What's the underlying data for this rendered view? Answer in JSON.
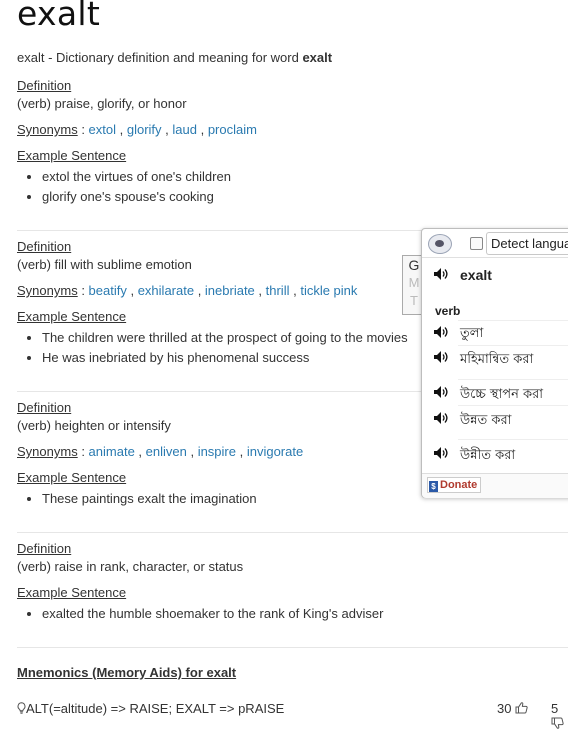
{
  "word": "exalt",
  "intro": {
    "prefix": "exalt - Dictionary definition and meaning for word ",
    "word": "exalt"
  },
  "labels": {
    "definition": "Definition",
    "synonyms": "Synonyms",
    "colon": " : ",
    "example": "Example Sentence"
  },
  "senses": [
    {
      "def": "(verb) praise, glorify, or honor",
      "synonyms": [
        "extol",
        "glorify",
        "laud",
        "proclaim"
      ],
      "examples": [
        "extol the virtues of one's children",
        "glorify one's spouse's cooking"
      ]
    },
    {
      "def": "(verb) fill with sublime emotion",
      "synonyms": [
        "beatify",
        "exhilarate",
        "inebriate",
        "thrill",
        "tickle pink"
      ],
      "examples": [
        "The children were thrilled at the prospect of going to the movies",
        "He was inebriated by his phenomenal success"
      ]
    },
    {
      "def": "(verb) heighten or intensify",
      "synonyms": [
        "animate",
        "enliven",
        "inspire",
        "invigorate"
      ],
      "examples": [
        "These paintings exalt the imagination"
      ]
    },
    {
      "def": "(verb) raise in rank, character, or status",
      "synonyms": [],
      "examples": [
        "exalted the humble shoemaker to the rank of King's adviser"
      ]
    }
  ],
  "mnemonics": {
    "heading": "Mnemonics (Memory Aids) for exalt",
    "text": "ALT(=altitude) => RAISE; EXALT => pRAISE",
    "up_votes": "30",
    "down_votes": "5"
  },
  "translator": {
    "detect_label": "Detect language",
    "side_letters": [
      "G",
      "M",
      "T"
    ],
    "word": "exalt",
    "pos": "verb",
    "translations": [
      "তুলা",
      "মহিমান্বিত করা",
      "উচ্চে স্থাপন করা",
      "উন্নত করা",
      "উন্নীত করা"
    ],
    "donate": "Donate"
  },
  "colors": {
    "link": "#2a7ab0",
    "text": "#333333",
    "donate": "#b03a2e"
  }
}
